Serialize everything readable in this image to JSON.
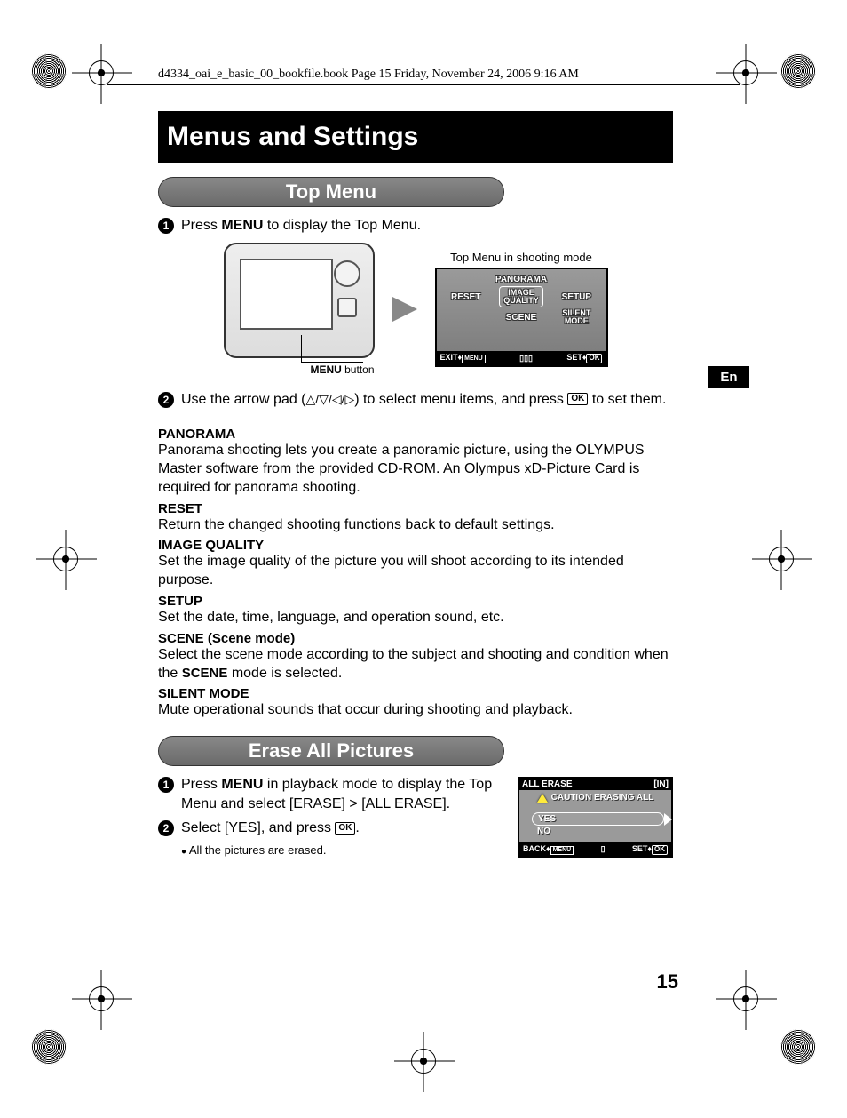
{
  "header_line": "d4334_oai_e_basic_00_bookfile.book  Page 15  Friday, November 24, 2006  9:16 AM",
  "chapter_title": "Menus and Settings",
  "lang_tab": "En",
  "page_number": "15",
  "section1": {
    "title": "Top Menu",
    "step1_pre": "Press ",
    "step1_bold": "MENU",
    "step1_post": " to display the Top Menu.",
    "menu_button_label_bold": "MENU",
    "menu_button_label_rest": " button",
    "lcd_caption": "Top Menu in shooting mode",
    "lcd": {
      "top": "PANORAMA",
      "left": "RESET",
      "center_l1": "IMAGE",
      "center_l2": "QUALITY",
      "right": "SETUP",
      "bottom_left": "SCENE",
      "bottom_right_l1": "SILENT",
      "bottom_right_l2": "MODE",
      "bar_exit": "EXIT",
      "bar_menu": "MENU",
      "bar_set": "SET",
      "bar_ok": "OK"
    },
    "step2_pre": "Use the arrow pad (",
    "step2_arrows": "△/▽/◁/▷",
    "step2_mid": ") to select menu items, and press ",
    "step2_ok": "OK",
    "step2_post": " to set them.",
    "terms": {
      "panorama_h": "PANORAMA",
      "panorama_b": "Panorama shooting lets you create a panoramic picture, using the OLYMPUS Master software from the provided CD-ROM. An Olympus xD-Picture Card is required for panorama shooting.",
      "reset_h": "RESET",
      "reset_b": "Return the changed shooting functions back to default settings.",
      "iq_h": "IMAGE QUALITY",
      "iq_b": "Set the image quality of the picture you will shoot according to its intended purpose.",
      "setup_h": "SETUP",
      "setup_b": "Set the date, time, language, and operation sound, etc.",
      "scene_h": "SCENE (Scene mode)",
      "scene_b_pre": "Select the scene mode according to the subject and shooting and condition when the ",
      "scene_b_inline": "SCENE",
      "scene_b_post": " mode is selected.",
      "silent_h": "SILENT MODE",
      "silent_b": "Mute operational sounds that occur during shooting and playback."
    }
  },
  "section2": {
    "title": "Erase All Pictures",
    "step1_pre": "Press ",
    "step1_bold": "MENU",
    "step1_post": " in playback mode to display the Top Menu and select [ERASE] > [ALL ERASE].",
    "step2_pre": "Select [YES], and press ",
    "step2_ok": "OK",
    "step2_post": ".",
    "sub_bullet": "All the pictures are erased.",
    "lcd": {
      "title_left": "ALL ERASE",
      "title_right": "[IN]",
      "warn": "CAUTION ERASING ALL",
      "opt_yes": "YES",
      "opt_no": "NO",
      "bar_back": "BACK",
      "bar_menu": "MENU",
      "bar_set": "SET",
      "bar_ok": "OK"
    }
  }
}
